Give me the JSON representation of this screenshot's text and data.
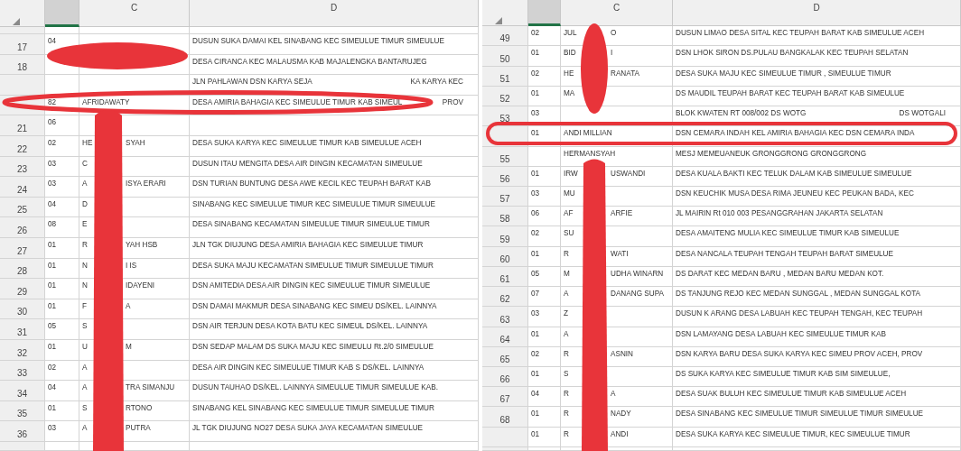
{
  "panels": [
    {
      "columns": [
        {
          "selected": true
        },
        {
          "label": "C",
          "selected": false
        },
        {
          "label": "D",
          "selected": false
        }
      ],
      "rows": [
        {
          "row": "17",
          "code": "04",
          "address": [
            "DUSUN SUKA DAMAI KEL SINABANG KEC SIMEULUE TIMUR SIMEULUE"
          ]
        },
        {
          "row": "18",
          "address": [
            "DESA CIRANCA KEC MALAUSMA KAB MAJALENGKA BANTARUJEG"
          ]
        },
        {
          "address": [
            "JLN PAHLAWAN DSN KARYA SEJA",
            "KA KARYA KEC"
          ]
        },
        {
          "code": "82",
          "name": [
            "AFRIDAWATY"
          ],
          "address": [
            "DESA AMIRIA BAHAGIA KEC SIMEULUE TIMUR KAB SIMEUL",
            "PROV"
          ]
        },
        {
          "row": "21",
          "code": "06"
        },
        {
          "row": "22",
          "code": "02",
          "name": [
            "HE",
            "SYAH"
          ],
          "address": [
            "DESA SUKA KARYA KEC SIMEULUE TIMUR KAB SIMEULUE ACEH"
          ]
        },
        {
          "row": "23",
          "code": "03",
          "name": [
            "C"
          ],
          "address": [
            "DUSUN ITAU MENGITA DESA AIR DINGIN KECAMATAN SIMEULUE"
          ]
        },
        {
          "row": "24",
          "code": "03",
          "name": [
            "A",
            "ISYA ERARI"
          ],
          "address": [
            "DSN TURIAN BUNTUNG DESA AWE KECIL KEC TEUPAH BARAT KAB"
          ]
        },
        {
          "row": "25",
          "code": "04",
          "name": [
            "D"
          ],
          "address": [
            "SINABANG KEC SIMEULUE TIMUR KEC SIMEULUE TIMUR SIMEULUE"
          ]
        },
        {
          "row": "26",
          "code": "08",
          "name": [
            "E"
          ],
          "address": [
            "DESA SINABANG KECAMATAN SIMEULUE TIMUR SIMEULUE TIMUR"
          ]
        },
        {
          "row": "27",
          "code": "01",
          "name": [
            "R",
            "YAH HSB"
          ],
          "address": [
            "JLN TGK DIUJUNG DESA AMIRIA BAHAGIA KEC SIMEULUE TIMUR"
          ]
        },
        {
          "row": "28",
          "code": "01",
          "name": [
            "N",
            "I IS"
          ],
          "address": [
            "DESA SUKA MAJU KECAMATAN SIMEULUE TIMUR SIMEULUE TIMUR"
          ]
        },
        {
          "row": "29",
          "code": "01",
          "name": [
            "N",
            "IDAYENI"
          ],
          "address": [
            "DSN AMITEDIA DESA AIR DINGIN KEC SIMEULUE TIMUR SIMEULUE"
          ]
        },
        {
          "row": "30",
          "code": "01",
          "name": [
            "F",
            "A"
          ],
          "address": [
            "DSN DAMAI MAKMUR DESA SINABANG KEC SIMEU DS/KEL. LAINNYA"
          ]
        },
        {
          "row": "31",
          "code": "05",
          "name": [
            "S"
          ],
          "address": [
            "DSN AIR TERJUN DESA KOTA BATU KEC SIMEUL DS/KEL. LAINNYA"
          ]
        },
        {
          "row": "32",
          "code": "01",
          "name": [
            "U",
            "M"
          ],
          "address": [
            "DSN SEDAP MALAM DS SUKA MAJU KEC SIMEULU Rt.2/0 SIMEULUE"
          ]
        },
        {
          "row": "33",
          "code": "02",
          "name": [
            "A"
          ],
          "address": [
            "DESA AIR DINGIN KEC SIMEULUE TIMUR KAB S DS/KEL. LAINNYA"
          ]
        },
        {
          "row": "34",
          "code": "04",
          "name": [
            "A",
            "TRA SIMANJU"
          ],
          "address": [
            "DUSUN TAUHAO DS/KEL. LAINNYA SIMEULUE TIMUR SIMEULUE KAB."
          ]
        },
        {
          "row": "35",
          "code": "01",
          "name": [
            "S",
            "RTONO"
          ],
          "address": [
            "SINABANG KEL SINABANG KEC SIMEULUE TIMUR SIMEULUE TIMUR"
          ]
        },
        {
          "row": "36",
          "code": "03",
          "name": [
            "A",
            "PUTRA"
          ],
          "address": [
            "JL TGK DIUJUNG NO27 DESA SUKA JAYA KECAMATAN SIMEULUE"
          ]
        }
      ]
    },
    {
      "columns": [
        {
          "selected": true
        },
        {
          "label": "C",
          "selected": false
        },
        {
          "label": "D",
          "selected": false
        }
      ],
      "rows": [
        {
          "row": "49",
          "code": "02",
          "name": [
            "JUL",
            "O"
          ],
          "address": [
            "DUSUN LIMAO DESA SITAL KEC TEUPAH BARAT KAB SIMEULUE ACEH"
          ]
        },
        {
          "row": "50",
          "code": "01",
          "name": [
            "BID",
            "I"
          ],
          "address": [
            "DSN LHOK SIRON DS.PULAU BANGKALAK KEC TEUPAH SELATAN"
          ]
        },
        {
          "row": "51",
          "code": "02",
          "name": [
            "HE",
            "RANATA"
          ],
          "address": [
            "DESA SUKA MAJU KEC SIMEULUE TIMUR , SIMEULUE TIMUR"
          ]
        },
        {
          "row": "52",
          "code": "01",
          "name": [
            "MA"
          ],
          "address": [
            "DS MAUDIL TEUPAH BARAT KEC TEUPAH BARAT KAB SIMEULUE"
          ]
        },
        {
          "row": "53",
          "code": "03",
          "address": [
            "BLOK KWATEN RT 008/002 DS WOTG",
            "DS WOTGALI"
          ]
        },
        {
          "code": "01",
          "name": [
            "ANDI MILLIAN"
          ],
          "address": [
            "DSN CEMARA INDAH KEL AMIRIA BAHAGIA KEC DSN CEMARA INDA"
          ]
        },
        {
          "row": "55",
          "name": [
            "HERMANSYAH"
          ],
          "address": [
            "MESJ MEMEUANEUK GRONGGRONG GRONGGRONG"
          ]
        },
        {
          "row": "56",
          "code": "01",
          "name": [
            "IRW",
            "USWANDI"
          ],
          "address": [
            "DESA KUALA BAKTI KEC TELUK DALAM KAB SIMEULUE SIMEULUE"
          ]
        },
        {
          "row": "57",
          "code": "03",
          "name": [
            "MU"
          ],
          "address": [
            "DSN KEUCHIK MUSA DESA RIMA JEUNEU KEC PEUKAN BADA, KEC"
          ]
        },
        {
          "row": "58",
          "code": "06",
          "name": [
            "AF",
            "ARFIE"
          ],
          "address": [
            "JL MAIRIN Rt 010 003 PESANGGRAHAN JAKARTA SELATAN"
          ]
        },
        {
          "row": "59",
          "code": "02",
          "name": [
            "SU"
          ],
          "address": [
            "DESA AMAITENG MULIA KEC SIMEULUE TIMUR KAB SIMEULUE"
          ]
        },
        {
          "row": "60",
          "code": "01",
          "name": [
            "R",
            "WATI"
          ],
          "address": [
            "DESA NANCALA TEUPAH TENGAH TEUPAH BARAT SIMEULUE"
          ]
        },
        {
          "row": "61",
          "code": "05",
          "name": [
            "M",
            "UDHA WINARN"
          ],
          "address": [
            "DS DARAT KEC MEDAN BARU , MEDAN BARU MEDAN KOT."
          ]
        },
        {
          "row": "62",
          "code": "07",
          "name": [
            "A",
            "DANANG SUPA"
          ],
          "address": [
            "DS TANJUNG REJO KEC MEDAN SUNGGAL , MEDAN SUNGGAL KOTA"
          ]
        },
        {
          "row": "63",
          "code": "03",
          "name": [
            "Z"
          ],
          "address": [
            "DUSUN K ARANG DESA LABUAH KEC TEUPAH TENGAH, KEC TEUPAH"
          ]
        },
        {
          "row": "64",
          "code": "01",
          "name": [
            "A"
          ],
          "address": [
            "DSN LAMAYANG DESA LABUAH KEC SIMEULUE TIMUR KAB"
          ]
        },
        {
          "row": "65",
          "code": "02",
          "name": [
            "R",
            "ASNIN"
          ],
          "address": [
            "DSN KARYA BARU DESA SUKA KARYA KEC SIMEU PROV ACEH, PROV"
          ]
        },
        {
          "row": "66",
          "code": "01",
          "name": [
            "S"
          ],
          "address": [
            "DS SUKA KARYA KEC SIMEULUE TIMUR KAB SIM SIMEULUE,"
          ]
        },
        {
          "row": "67",
          "code": "04",
          "name": [
            "R",
            "A"
          ],
          "address": [
            "DESA SUAK BULUH KEC SIMEULUE TIMUR KAB SIMEULUE ACEH"
          ]
        },
        {
          "row": "68",
          "code": "01",
          "name": [
            "R",
            "NADY"
          ],
          "address": [
            "DESA SINABANG KEC SIMEULUE TIMUR SIMEULUE TIMUR SIMEULUE"
          ]
        },
        {
          "code": "01",
          "name": [
            "R",
            "ANDI"
          ],
          "address": [
            "DESA SUKA KARYA KEC SIMEULUE TIMUR, KEC SIMEULUE TIMUR"
          ]
        }
      ]
    }
  ]
}
